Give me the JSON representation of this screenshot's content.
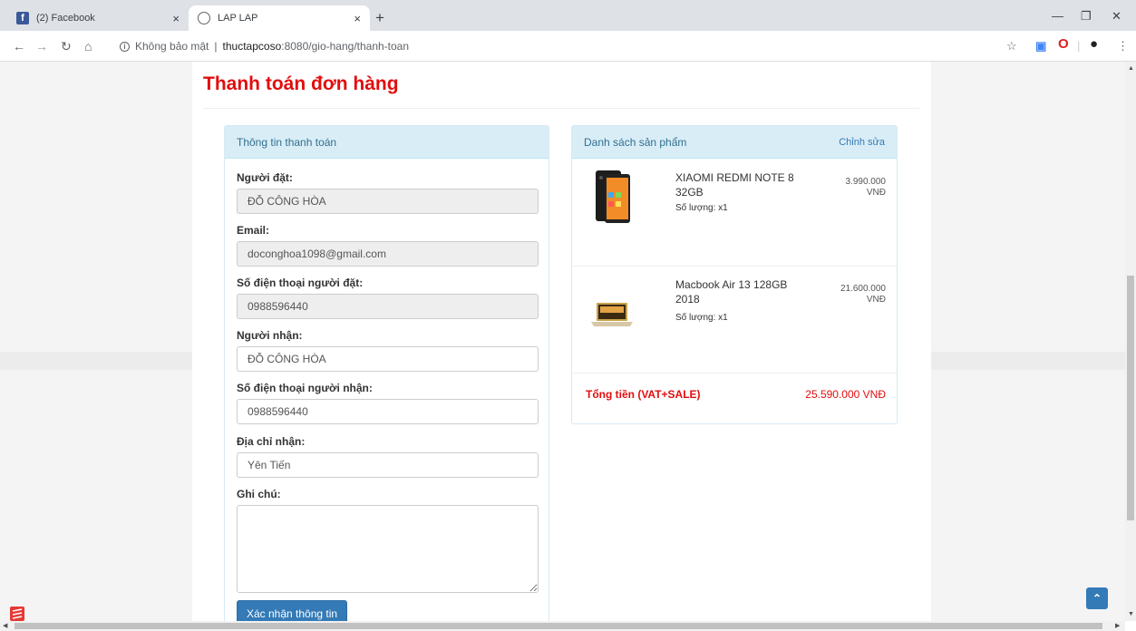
{
  "browser": {
    "tabs": [
      {
        "title": "(2) Facebook",
        "favicon": "facebook-icon"
      },
      {
        "title": "LAP LAP",
        "favicon": "globe-icon"
      }
    ],
    "new_tab": "+",
    "close_glyph": "×",
    "address": {
      "security": "Không bảo mật",
      "separator": "|",
      "host": "thuctapcoso",
      "rest": ":8080/gio-hang/thanh-toan"
    }
  },
  "page": {
    "title": "Thanh toán đơn hàng",
    "form": {
      "heading": "Thông tin thanh toán",
      "fields": [
        {
          "label": "Người đặt:",
          "value": "ĐỖ CÔNG HÒA"
        },
        {
          "label": "Email:",
          "value": "doconghoa1098@gmail.com"
        },
        {
          "label": "Số điện thoại người đặt:",
          "value": "0988596440"
        },
        {
          "label": "Người nhận:",
          "value": "ĐỖ CÔNG HÒA"
        },
        {
          "label": "Số điện thoại người nhận:",
          "value": "0988596440"
        },
        {
          "label": "Địa chỉ nhận:",
          "value": "Yên Tiến"
        },
        {
          "label": "Ghi chú:",
          "value": ""
        }
      ],
      "submit_label": "Xác nhận thông tin"
    },
    "cart": {
      "heading": "Danh sách sản phẩm",
      "edit_label": "Chỉnh sửa",
      "items": [
        {
          "name": "XIAOMI REDMI NOTE 8 32GB",
          "qty": "Số lượng: x1",
          "price": "3.990.000",
          "currency": "VNĐ"
        },
        {
          "name": "Macbook Air 13 128GB 2018",
          "qty": "Số lượng: x1",
          "price": "21.600.000",
          "currency": "VNĐ"
        }
      ],
      "total_label": "Tổng tiền (VAT+SALE)",
      "total_value": "25.590.000 VNĐ"
    }
  },
  "colors": {
    "title_red": "#e10e0e",
    "panel_head_bg": "#d9edf7",
    "button_blue": "#337ab7"
  }
}
